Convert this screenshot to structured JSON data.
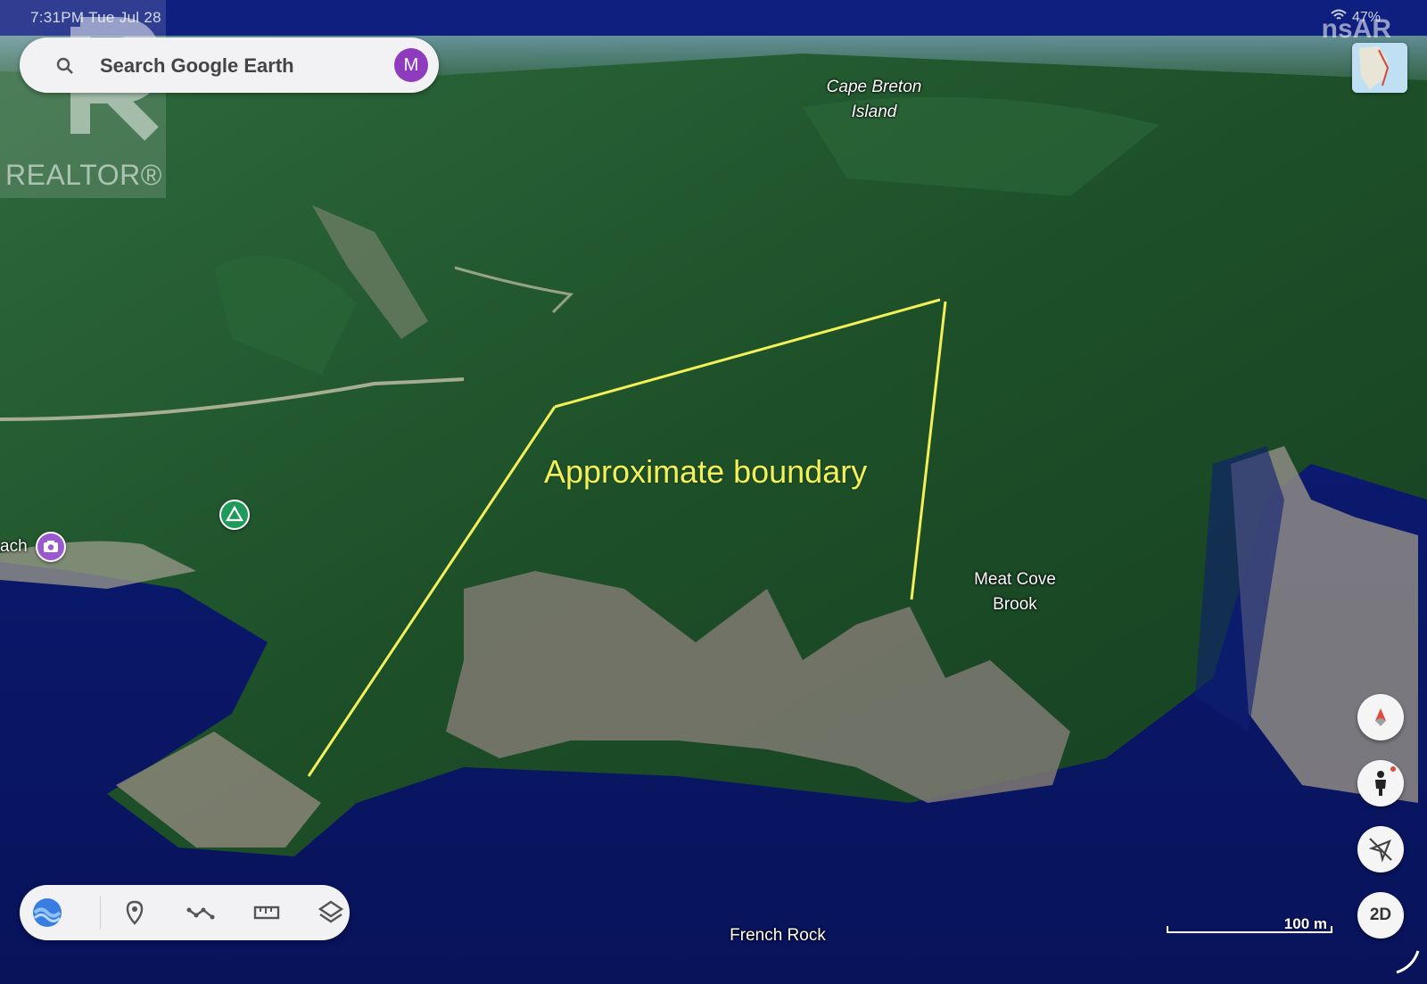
{
  "status_bar": {
    "time": "7:31PM",
    "date": "Tue Jul 28",
    "battery": "47%"
  },
  "search": {
    "placeholder": "Search Google Earth",
    "avatar_initial": "M",
    "avatar_color": "#8e3bbd"
  },
  "watermarks": {
    "realtor": "REALTOR®",
    "nsar": "nsAR"
  },
  "map_labels": {
    "island": "Cape Breton Island",
    "island_line1": "Cape Breton",
    "island_line2": "Island",
    "brook_line1": "Meat Cove",
    "brook_line2": "Brook",
    "rock": "French Rock",
    "beach_partial": "ach"
  },
  "annotation": {
    "boundary_label": "Approximate boundary",
    "line_color": "#f3f05a"
  },
  "toolbar": {
    "items": [
      "voyager-icon",
      "placemark-icon",
      "path-icon",
      "measure-icon",
      "layers-icon"
    ]
  },
  "controls": {
    "compass": "compass-icon",
    "street_view": "pegman-icon",
    "location": "location-off-icon",
    "view_mode": "2D"
  },
  "scale": {
    "label": "100 m"
  },
  "colors": {
    "water": "#0b1a6e",
    "forest": "#1f5a2c",
    "ui_surface": "#f2f2f4"
  }
}
